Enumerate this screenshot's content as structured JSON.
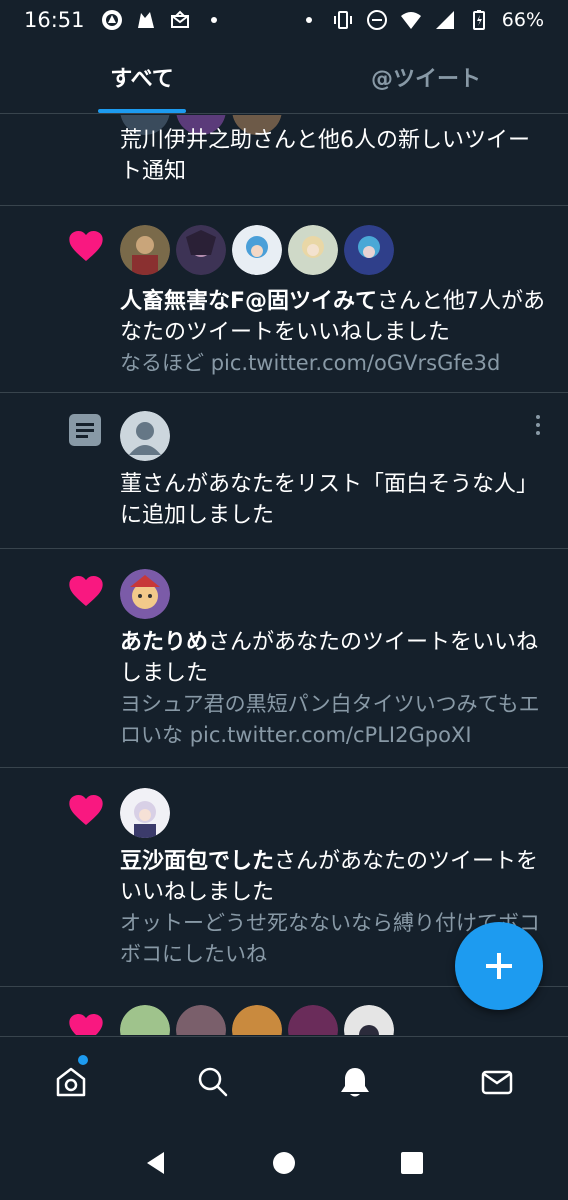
{
  "status_bar": {
    "time": "16:51",
    "battery": "66%",
    "left_icons": [
      "app-notification-icon",
      "cat-icon",
      "mail-icon",
      "dot-icon"
    ],
    "right_icons": [
      "dot-icon",
      "vibrate-icon",
      "dnd-icon",
      "wifi-icon",
      "signal-icon",
      "battery-icon"
    ]
  },
  "tabs": [
    {
      "label": "すべて",
      "active": true
    },
    {
      "label": "@ツイート",
      "active": false
    }
  ],
  "notifications": [
    {
      "type": "new-tweets",
      "text": "荒川伊井之助さんと他6人の新しいツイート通知"
    },
    {
      "type": "like",
      "icon": "heart-icon",
      "bold": "人畜無害なF@固ツイみて",
      "text": "さんと他7人があなたのツイートをいいねしました",
      "sub_text": "なるほど ",
      "sub_link": "pic.twitter.com/oGVrsGfe3d"
    },
    {
      "type": "list",
      "icon": "list-icon",
      "text": "菫さんがあなたをリスト「面白そうな人」に追加しました"
    },
    {
      "type": "like",
      "icon": "heart-icon",
      "bold": "あたりめ",
      "text": "さんがあなたのツイートをいいねしました",
      "sub_text": "ヨシュア君の黒短パン白タイツいつみてもエロいな ",
      "sub_link": "pic.twitter.com/cPLI2GpoXI"
    },
    {
      "type": "like",
      "icon": "heart-icon",
      "bold": "豆沙面包でした",
      "text": "さんがあなたのツイートをいいねしました",
      "sub_text": "オットーどうせ死なないなら縛り付けてボコボコにしたいね"
    },
    {
      "type": "like",
      "icon": "heart-icon"
    }
  ],
  "colors": {
    "background": "#15202b",
    "accent": "#1d9bf0",
    "like": "#f91880",
    "muted": "#8899a6",
    "divider": "#38444d"
  },
  "bottom_nav": [
    "home-icon",
    "search-icon",
    "notifications-icon",
    "messages-icon"
  ],
  "fab": {
    "icon": "plus-icon"
  },
  "system_nav": [
    "back-icon",
    "home-button-icon",
    "recents-icon"
  ]
}
